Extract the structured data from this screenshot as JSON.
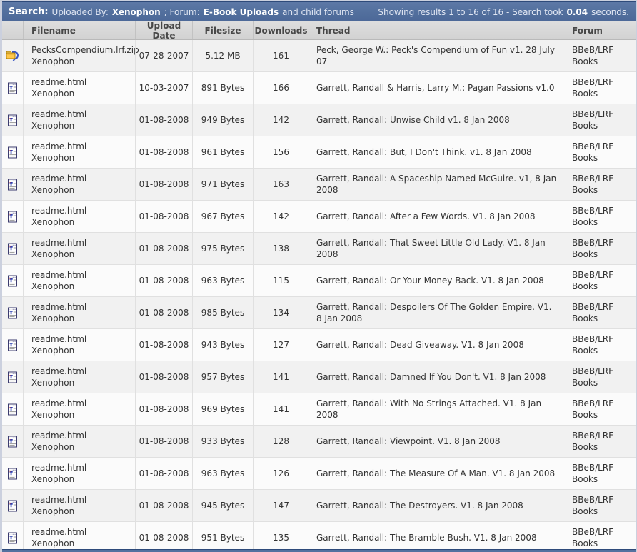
{
  "title_bar": {
    "search_label": "Search:",
    "uploaded_by_label": "Uploaded By:",
    "user_link": "Xenophon",
    "forum_label": "; Forum:",
    "forum_link": "E-Book Uploads",
    "child_note": "and child forums",
    "results_prefix": "Showing results 1 to 16 of 16 - Search took",
    "results_time": "0.04",
    "results_suffix": "seconds."
  },
  "colors": {
    "titlebar_blue": "#54719f",
    "header_gray": "#d4d4d4",
    "row_alt": "#f1f1f1",
    "page_background": "#cbd0de"
  },
  "table": {
    "columns": [
      "Filename",
      "Upload Date",
      "Filesize",
      "Downloads",
      "Thread",
      "Forum"
    ],
    "rows": [
      {
        "icon": "zip-icon",
        "filename": "PecksCompendium.lrf.zip",
        "uploader": "Xenophon",
        "upload_date": "07-28-2007",
        "filesize": "5.12 MB",
        "downloads": "161",
        "thread": "Peck, George W.: Peck's Compendium of Fun v1. 28 July 07",
        "forum": "BBeB/LRF Books"
      },
      {
        "icon": "html-icon",
        "filename": "readme.html",
        "uploader": "Xenophon",
        "upload_date": "10-03-2007",
        "filesize": "891 Bytes",
        "downloads": "166",
        "thread": "Garrett, Randall & Harris, Larry M.: Pagan Passions v1.0",
        "forum": "BBeB/LRF Books"
      },
      {
        "icon": "html-icon",
        "filename": "readme.html",
        "uploader": "Xenophon",
        "upload_date": "01-08-2008",
        "filesize": "949 Bytes",
        "downloads": "142",
        "thread": "Garrett, Randall: Unwise Child v1. 8 Jan 2008",
        "forum": "BBeB/LRF Books"
      },
      {
        "icon": "html-icon",
        "filename": "readme.html",
        "uploader": "Xenophon",
        "upload_date": "01-08-2008",
        "filesize": "961 Bytes",
        "downloads": "156",
        "thread": "Garrett, Randall: But, I Don't Think. v1. 8 Jan 2008",
        "forum": "BBeB/LRF Books"
      },
      {
        "icon": "html-icon",
        "filename": "readme.html",
        "uploader": "Xenophon",
        "upload_date": "01-08-2008",
        "filesize": "971 Bytes",
        "downloads": "163",
        "thread": "Garrett, Randall: A Spaceship Named McGuire. v1, 8 Jan 2008",
        "forum": "BBeB/LRF Books"
      },
      {
        "icon": "html-icon",
        "filename": "readme.html",
        "uploader": "Xenophon",
        "upload_date": "01-08-2008",
        "filesize": "967 Bytes",
        "downloads": "142",
        "thread": "Garrett, Randall: After a Few Words. V1. 8 Jan 2008",
        "forum": "BBeB/LRF Books"
      },
      {
        "icon": "html-icon",
        "filename": "readme.html",
        "uploader": "Xenophon",
        "upload_date": "01-08-2008",
        "filesize": "975 Bytes",
        "downloads": "138",
        "thread": "Garrett, Randall: That Sweet Little Old Lady. V1. 8 Jan 2008",
        "forum": "BBeB/LRF Books"
      },
      {
        "icon": "html-icon",
        "filename": "readme.html",
        "uploader": "Xenophon",
        "upload_date": "01-08-2008",
        "filesize": "963 Bytes",
        "downloads": "115",
        "thread": "Garrett, Randall: Or Your Money Back. V1. 8 Jan 2008",
        "forum": "BBeB/LRF Books"
      },
      {
        "icon": "html-icon",
        "filename": "readme.html",
        "uploader": "Xenophon",
        "upload_date": "01-08-2008",
        "filesize": "985 Bytes",
        "downloads": "134",
        "thread": "Garrett, Randall: Despoilers Of The Golden Empire. V1. 8 Jan 2008",
        "forum": "BBeB/LRF Books"
      },
      {
        "icon": "html-icon",
        "filename": "readme.html",
        "uploader": "Xenophon",
        "upload_date": "01-08-2008",
        "filesize": "943 Bytes",
        "downloads": "127",
        "thread": "Garrett, Randall: Dead Giveaway. V1. 8 Jan 2008",
        "forum": "BBeB/LRF Books"
      },
      {
        "icon": "html-icon",
        "filename": "readme.html",
        "uploader": "Xenophon",
        "upload_date": "01-08-2008",
        "filesize": "957 Bytes",
        "downloads": "141",
        "thread": "Garrett, Randall: Damned If You Don't. V1. 8 Jan 2008",
        "forum": "BBeB/LRF Books"
      },
      {
        "icon": "html-icon",
        "filename": "readme.html",
        "uploader": "Xenophon",
        "upload_date": "01-08-2008",
        "filesize": "969 Bytes",
        "downloads": "141",
        "thread": "Garrett, Randall: With No Strings Attached. V1. 8 Jan 2008",
        "forum": "BBeB/LRF Books"
      },
      {
        "icon": "html-icon",
        "filename": "readme.html",
        "uploader": "Xenophon",
        "upload_date": "01-08-2008",
        "filesize": "933 Bytes",
        "downloads": "128",
        "thread": "Garrett, Randall: Viewpoint. V1. 8 Jan 2008",
        "forum": "BBeB/LRF Books"
      },
      {
        "icon": "html-icon",
        "filename": "readme.html",
        "uploader": "Xenophon",
        "upload_date": "01-08-2008",
        "filesize": "963 Bytes",
        "downloads": "126",
        "thread": "Garrett, Randall: The Measure Of A Man. V1. 8 Jan 2008",
        "forum": "BBeB/LRF Books"
      },
      {
        "icon": "html-icon",
        "filename": "readme.html",
        "uploader": "Xenophon",
        "upload_date": "01-08-2008",
        "filesize": "945 Bytes",
        "downloads": "147",
        "thread": "Garrett, Randall: The Destroyers. V1. 8 Jan 2008",
        "forum": "BBeB/LRF Books"
      },
      {
        "icon": "html-icon",
        "filename": "readme.html",
        "uploader": "Xenophon",
        "upload_date": "01-08-2008",
        "filesize": "951 Bytes",
        "downloads": "135",
        "thread": "Garrett, Randall: The Bramble Bush. V1. 8 Jan 2008",
        "forum": "BBeB/LRF Books"
      }
    ]
  }
}
